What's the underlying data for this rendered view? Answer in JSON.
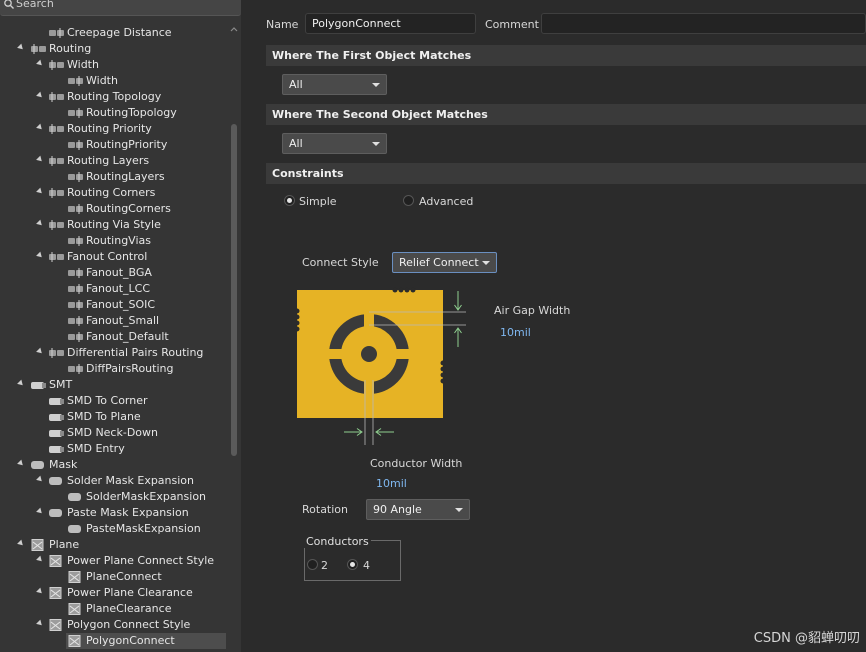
{
  "search": {
    "label": "Search"
  },
  "tree": [
    {
      "label": "Creepage Distance",
      "indent": 2,
      "icon": "rule-item-icon",
      "arrow": false
    },
    {
      "label": "Routing",
      "indent": 1,
      "icon": "rule-category-icon",
      "arrow": true
    },
    {
      "label": "Width",
      "indent": 2,
      "icon": "rule-category-icon",
      "arrow": true
    },
    {
      "label": "Width",
      "indent": 3,
      "icon": "rule-item-icon",
      "arrow": false
    },
    {
      "label": "Routing Topology",
      "indent": 2,
      "icon": "rule-category-icon",
      "arrow": true
    },
    {
      "label": "RoutingTopology",
      "indent": 3,
      "icon": "rule-item-icon",
      "arrow": false
    },
    {
      "label": "Routing Priority",
      "indent": 2,
      "icon": "rule-category-icon",
      "arrow": true
    },
    {
      "label": "RoutingPriority",
      "indent": 3,
      "icon": "rule-item-icon",
      "arrow": false
    },
    {
      "label": "Routing Layers",
      "indent": 2,
      "icon": "rule-category-icon",
      "arrow": true
    },
    {
      "label": "RoutingLayers",
      "indent": 3,
      "icon": "rule-item-icon",
      "arrow": false
    },
    {
      "label": "Routing Corners",
      "indent": 2,
      "icon": "rule-category-icon",
      "arrow": true
    },
    {
      "label": "RoutingCorners",
      "indent": 3,
      "icon": "rule-item-icon",
      "arrow": false
    },
    {
      "label": "Routing Via Style",
      "indent": 2,
      "icon": "rule-category-icon",
      "arrow": true
    },
    {
      "label": "RoutingVias",
      "indent": 3,
      "icon": "rule-item-icon",
      "arrow": false
    },
    {
      "label": "Fanout Control",
      "indent": 2,
      "icon": "rule-category-icon",
      "arrow": true
    },
    {
      "label": "Fanout_BGA",
      "indent": 3,
      "icon": "rule-item-icon",
      "arrow": false
    },
    {
      "label": "Fanout_LCC",
      "indent": 3,
      "icon": "rule-item-icon",
      "arrow": false
    },
    {
      "label": "Fanout_SOIC",
      "indent": 3,
      "icon": "rule-item-icon",
      "arrow": false
    },
    {
      "label": "Fanout_Small",
      "indent": 3,
      "icon": "rule-item-icon",
      "arrow": false
    },
    {
      "label": "Fanout_Default",
      "indent": 3,
      "icon": "rule-item-icon",
      "arrow": false
    },
    {
      "label": "Differential Pairs Routing",
      "indent": 2,
      "icon": "rule-category-icon",
      "arrow": true
    },
    {
      "label": "DiffPairsRouting",
      "indent": 3,
      "icon": "rule-item-icon",
      "arrow": false
    },
    {
      "label": "SMT",
      "indent": 1,
      "icon": "smt-icon",
      "arrow": true
    },
    {
      "label": "SMD To Corner",
      "indent": 2,
      "icon": "smt-icon",
      "arrow": false
    },
    {
      "label": "SMD To Plane",
      "indent": 2,
      "icon": "smt-icon",
      "arrow": false
    },
    {
      "label": "SMD Neck-Down",
      "indent": 2,
      "icon": "smt-icon",
      "arrow": false
    },
    {
      "label": "SMD Entry",
      "indent": 2,
      "icon": "smt-icon",
      "arrow": false
    },
    {
      "label": "Mask",
      "indent": 1,
      "icon": "mask-icon",
      "arrow": true
    },
    {
      "label": "Solder Mask Expansion",
      "indent": 2,
      "icon": "mask-icon",
      "arrow": true
    },
    {
      "label": "SolderMaskExpansion",
      "indent": 3,
      "icon": "mask-icon",
      "arrow": false
    },
    {
      "label": "Paste Mask Expansion",
      "indent": 2,
      "icon": "mask-icon",
      "arrow": true
    },
    {
      "label": "PasteMaskExpansion",
      "indent": 3,
      "icon": "mask-icon",
      "arrow": false
    },
    {
      "label": "Plane",
      "indent": 1,
      "icon": "plane-icon",
      "arrow": true
    },
    {
      "label": "Power Plane Connect Style",
      "indent": 2,
      "icon": "plane-icon",
      "arrow": true
    },
    {
      "label": "PlaneConnect",
      "indent": 3,
      "icon": "plane-icon",
      "arrow": false
    },
    {
      "label": "Power Plane Clearance",
      "indent": 2,
      "icon": "plane-icon",
      "arrow": true
    },
    {
      "label": "PlaneClearance",
      "indent": 3,
      "icon": "plane-icon",
      "arrow": false
    },
    {
      "label": "Polygon Connect Style",
      "indent": 2,
      "icon": "plane-icon",
      "arrow": true
    },
    {
      "label": "PolygonConnect",
      "indent": 3,
      "icon": "plane-icon",
      "arrow": false,
      "selected": true
    }
  ],
  "form": {
    "name_label": "Name",
    "name_value": "PolygonConnect",
    "comment_label": "Comment",
    "comment_value": "",
    "first_match_header": "Where The First Object Matches",
    "first_match_value": "All",
    "second_match_header": "Where The Second Object Matches",
    "second_match_value": "All",
    "constraints_header": "Constraints",
    "simple_label": "Simple",
    "advanced_label": "Advanced",
    "mode_selected": "Simple",
    "connect_style_label": "Connect Style",
    "connect_style_value": "Relief Connect",
    "air_gap_label": "Air Gap Width",
    "air_gap_value": "10mil",
    "conductor_width_label": "Conductor Width",
    "conductor_width_value": "10mil",
    "rotation_label": "Rotation",
    "rotation_value": "90 Angle",
    "conductors_title": "Conductors",
    "conductors_opt_2": "2",
    "conductors_opt_4": "4",
    "conductors_selected": "4"
  },
  "watermark": "CSDN @貂蝉叨叨",
  "colors": {
    "copper": "#e6b325",
    "background": "#2b2b2b",
    "accent_blue": "#7fb7ef",
    "dimension_green": "#8fcf8f"
  }
}
